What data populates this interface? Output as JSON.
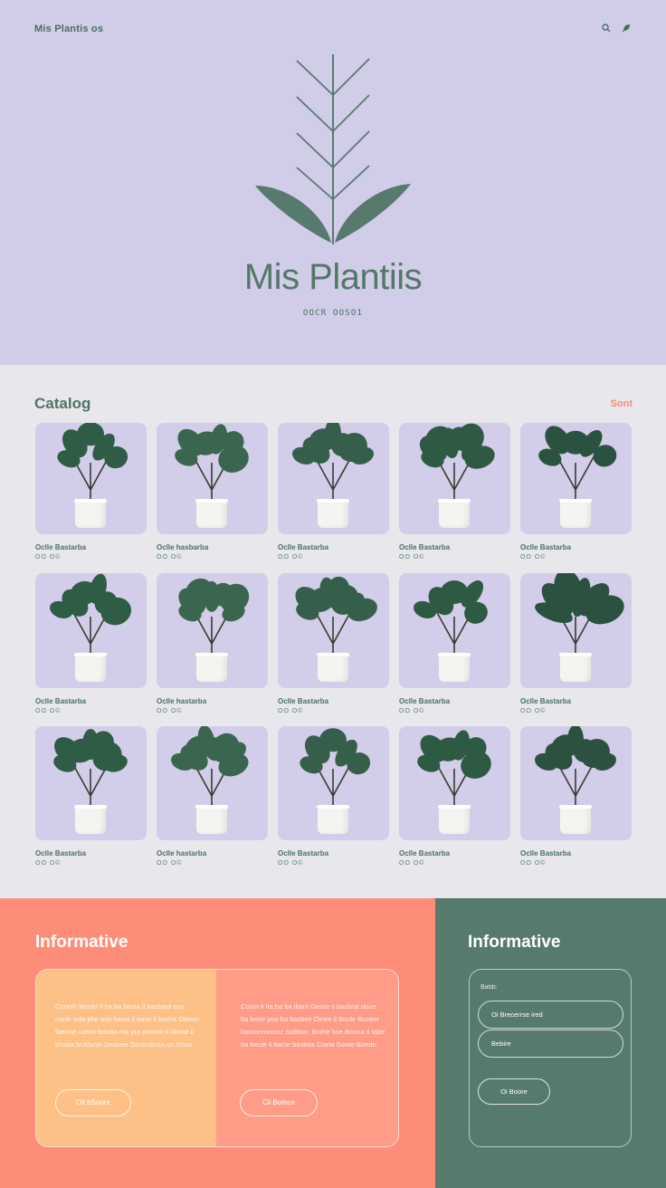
{
  "header": {
    "brand": "Mis Plantis os",
    "icons": [
      "search-icon",
      "leaf-icon"
    ]
  },
  "hero": {
    "title": "Mis Plantiis",
    "subtitle": "OOCR OOSO1"
  },
  "catalog": {
    "title": "Catalog",
    "link": "Sont",
    "items": [
      {
        "name": "Oclle Bastarba",
        "price": "OO O©"
      },
      {
        "name": "Oclle hasbarba",
        "price": "OO O©"
      },
      {
        "name": "Oclle Bastarba",
        "price": "OO O©"
      },
      {
        "name": "Oclle Bastarba",
        "price": "OO O©"
      },
      {
        "name": "Oclle Bastarba",
        "price": "OO O©"
      },
      {
        "name": "Oclle Bastarba",
        "price": "OO O©"
      },
      {
        "name": "Oclle hastarba",
        "price": "OO O©"
      },
      {
        "name": "Oclle Bastarba",
        "price": "OO O©"
      },
      {
        "name": "Oclle Bastarba",
        "price": "OO O©"
      },
      {
        "name": "Oclle Bastarba",
        "price": "OO O©"
      },
      {
        "name": "Oclle Bastarba",
        "price": "OO O©"
      },
      {
        "name": "Oclle hastarba",
        "price": "OO O©"
      },
      {
        "name": "Oclle Bastarba",
        "price": "OO O©"
      },
      {
        "name": "Oclle Bastarba",
        "price": "OO O©"
      },
      {
        "name": "Oclle Bastarba",
        "price": "OO O©"
      }
    ]
  },
  "footer": {
    "left": {
      "title": "Informative",
      "col1_text": "Coonth Becitit Il ha ba basta il basbard oue cacle sola phe oso basta ii base ii bashe Oteom faetroe caera ibdaba ma pra preona il biirnat ii bhaba bt bfante Deanee Oostrofinca oo Shoo.",
      "col1_button": "Oli bSoore",
      "col2_text": "Coom ii Ita ba ba ibarit Dasse ii basbrat doue ba beoe poo ba basbeit Oinee ii Boole Bocenr boororeoreocr Soblcor, Borhe hoe Boona Ii tabe ba becte Ii bacte basbria Coela Goote Boede.",
      "col2_button": "Cii Boince"
    },
    "right": {
      "title": "Informative",
      "form_label": "Batdc",
      "input1": "Oi Brecerrse ired",
      "input2": "Bebire",
      "button": "Oi Boore"
    }
  },
  "colors": {
    "hero_bg": "#d1cde9",
    "catalog_bg": "#e8e8ec",
    "accent_green": "#567a6c",
    "accent_coral": "#fd8d79",
    "accent_peach": "#fdc087"
  }
}
